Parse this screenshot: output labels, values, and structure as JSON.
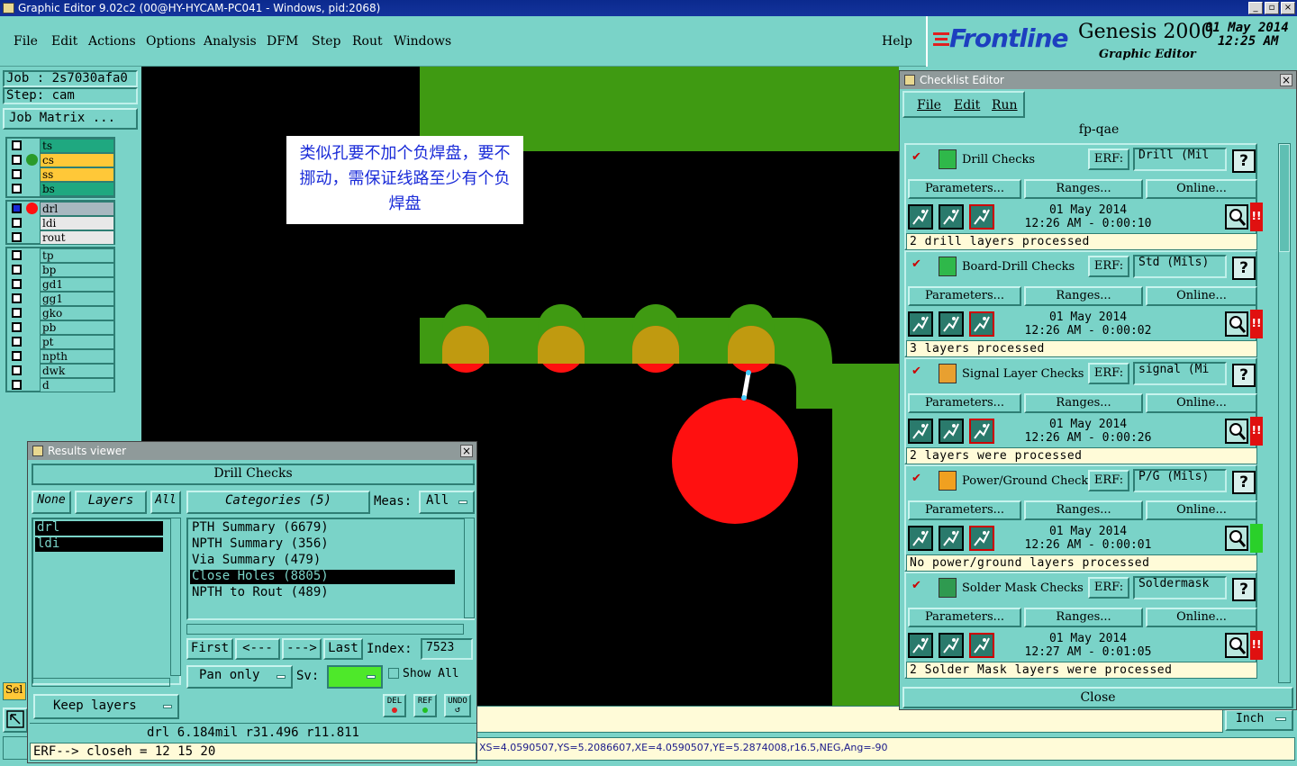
{
  "window": {
    "title": "Graphic Editor 9.02c2 (00@HY-HYCAM-PC041 - Windows, pid:2068)"
  },
  "menu": {
    "items": [
      "File",
      "Edit",
      "Actions",
      "Options",
      "Analysis",
      "DFM",
      "Step",
      "Rout",
      "Windows"
    ],
    "help": "Help"
  },
  "brand": {
    "logo": "Frontline",
    "product": "Genesis 2000",
    "subtitle": "Graphic Editor",
    "date": "01 May 2014",
    "time": "12:25 AM"
  },
  "job": {
    "job_line": "Job : 2s7030afa0",
    "step_line": "Step: cam",
    "matrix_button": "Job Matrix ..."
  },
  "layers": {
    "group1": [
      {
        "name": "ts",
        "bg": "#1fa880",
        "dot": ""
      },
      {
        "name": "cs",
        "bg": "#ffc838",
        "dot": "#2a9a2a"
      },
      {
        "name": "ss",
        "bg": "#ffc838",
        "dot": ""
      },
      {
        "name": "bs",
        "bg": "#1fa880",
        "dot": ""
      }
    ],
    "group2": [
      {
        "name": "drl",
        "bg": "#a8b8c0",
        "dot": "#ff1010"
      },
      {
        "name": "ldi",
        "bg": "#e8e8e8",
        "dot": ""
      },
      {
        "name": "rout",
        "bg": "#e8e8e8",
        "dot": ""
      }
    ],
    "group3": [
      "tp",
      "bp",
      "gd1",
      "gg1",
      "gko",
      "pb",
      "pt",
      "npth",
      "dwk",
      "d"
    ]
  },
  "annotation": {
    "text": "类似孔要不加个负焊盘，要不挪动，需保证线路至少有个负焊盘"
  },
  "results_viewer": {
    "title": "Results viewer",
    "header": "Drill Checks",
    "btn_none": "None",
    "btn_layers": "Layers",
    "btn_all": "All",
    "categories_label": "Categories (5)",
    "meas_label": "Meas:",
    "meas_value": "All",
    "layer_list": [
      "drl",
      "ldi"
    ],
    "categories": [
      "PTH Summary (6679)",
      "NPTH Summary (356)",
      "Via Summary (479)",
      "Close Holes (8805)",
      "NPTH to Rout (489)"
    ],
    "selected_category": 3,
    "nav": {
      "first": "First",
      "prev": "<---",
      "next": "--->",
      "last": "Last",
      "index_label": "Index:",
      "index_value": "7523"
    },
    "pan_mode": "Pan only",
    "sv_label": "Sv:",
    "show_all": "Show All",
    "keep_layers": "Keep layers",
    "tools": [
      "DEL",
      "REF",
      "UNDO"
    ],
    "status_line": "drl 6.184mil r31.496 r11.811",
    "erf_line": "ERF--> closeh = 12 15 20"
  },
  "checklist": {
    "title": "Checklist Editor",
    "menu": [
      "File",
      "Edit",
      "Run"
    ],
    "name": "fp-qae",
    "erf_label": "ERF:",
    "param_label": "Parameters...",
    "ranges_label": "Ranges...",
    "online_label": "Online...",
    "close_label": "Close",
    "sections": [
      {
        "title": "Drill Checks",
        "erf": "Drill (Mil",
        "date": "01 May 2014",
        "time": "12:26 AM - 0:00:10",
        "msg": "2 drill layers processed",
        "status": "red",
        "icon_color": "#2fb84a"
      },
      {
        "title": "Board-Drill Checks",
        "erf": "Std (Mils)",
        "date": "01 May 2014",
        "time": "12:26 AM - 0:00:02",
        "msg": "3 layers processed",
        "status": "red",
        "icon_color": "#2fb84a"
      },
      {
        "title": "Signal Layer Checks",
        "erf": "signal (Mi",
        "date": "01 May 2014",
        "time": "12:26 AM - 0:00:26",
        "msg": "2 layers were processed",
        "status": "red",
        "icon_color": "#e8a030"
      },
      {
        "title": "Power/Ground Checks",
        "erf": "P/G (Mils)",
        "date": "01 May 2014",
        "time": "12:26 AM - 0:00:01",
        "msg": "No power/ground layers processed",
        "status": "green",
        "icon_color": "#f0a020"
      },
      {
        "title": "Solder Mask Checks",
        "erf": "Soldermask",
        "date": "01 May 2014",
        "time": "12:27 AM - 0:01:05",
        "msg": "2 Solder Mask layers were processed",
        "status": "red",
        "icon_color": "#2f9a50"
      }
    ]
  },
  "bottom": {
    "sel_label": "Sel",
    "units": "Inch",
    "coords": "XS=4.0590507,YS=5.2086607,XE=4.0590507,YE=5.2874008,r16.5,NEG,Ang=-90"
  }
}
